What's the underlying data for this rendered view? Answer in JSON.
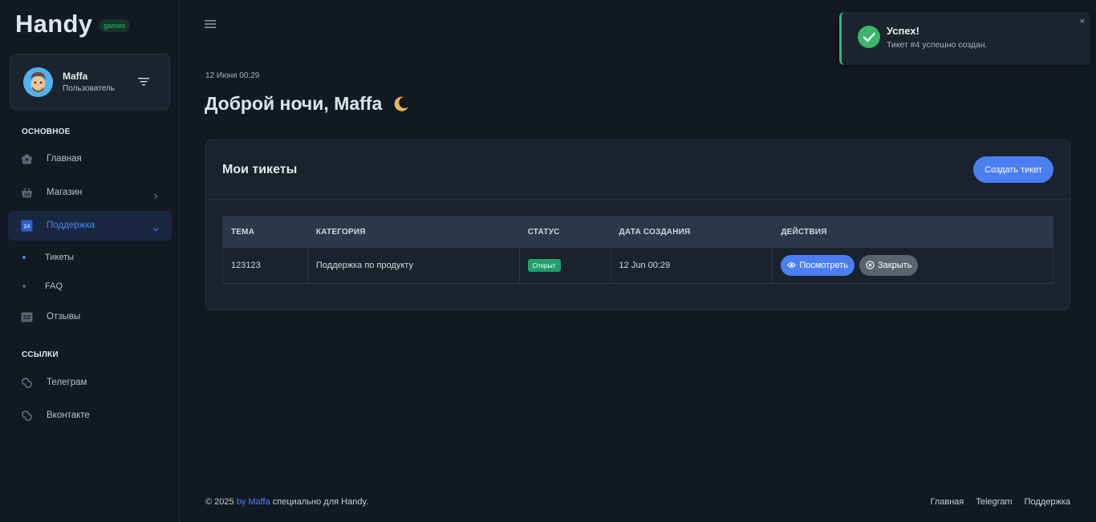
{
  "brand": {
    "name": "Handy",
    "badge": "games"
  },
  "user": {
    "name": "Maffa",
    "role": "Пользователь"
  },
  "sidebar": {
    "section_main": "Основное",
    "section_links": "Ссылки",
    "items": {
      "home": "Главная",
      "shop": "Магазин",
      "support": "Поддержка",
      "tickets": "Тикеты",
      "faq": "FAQ",
      "reviews": "Отзывы",
      "telegram": "Телеграм",
      "vk": "Вконтакте"
    }
  },
  "header": {
    "date": "12 Июня 00:29",
    "greeting": "Доброй ночи, Maffa"
  },
  "tickets_card": {
    "title": "Мои тикеты",
    "create_label": "Создать тикет",
    "columns": [
      "Тема",
      "Категория",
      "Статус",
      "Дата создания",
      "Действия"
    ],
    "rows": [
      {
        "subject": "123123",
        "category": "Поддержка по продукту",
        "status": "Открыт",
        "created": "12 Jun 00:29",
        "view_label": "Посмотреть",
        "close_label": "Закрыть"
      }
    ]
  },
  "toast": {
    "title": "Успех!",
    "message": "Тикет #4 успешно создан.",
    "close": "×"
  },
  "footer": {
    "copyright_prefix": "© 2025",
    "author": "by Maffa",
    "suffix": "специально для Handy.",
    "links": [
      "Главная",
      "Telegram",
      "Поддержка"
    ]
  },
  "colors": {
    "background": "#121923",
    "accent": "#4a7ff3",
    "success": "#2bb673",
    "card": "#1a222d"
  }
}
